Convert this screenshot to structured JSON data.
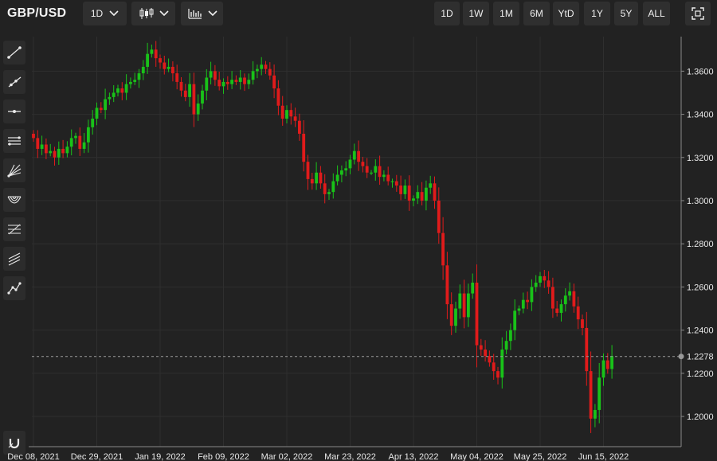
{
  "header": {
    "symbol": "GBP/USD",
    "interval": "1D",
    "ranges": [
      "1D",
      "1W",
      "1M",
      "6M",
      "YtD",
      "1Y",
      "5Y",
      "ALL"
    ],
    "icons": [
      "chevron-down-icon",
      "candlestick-icon",
      "chart-type-icon",
      "fullscreen-icon"
    ]
  },
  "drawing_tools": [
    "trend-line-icon",
    "ray-icon",
    "horizontal-line-icon",
    "parallel-channel-icon",
    "fan-icon",
    "arc-icon",
    "fibonacci-icon",
    "gann-icon",
    "path-icon",
    "magnet-icon"
  ],
  "colors": {
    "up": "#19c219",
    "down": "#e01b1b",
    "background": "#222222",
    "grid": "#2f2f2f"
  },
  "chart_data": {
    "type": "candlestick",
    "title": "GBP/USD",
    "xlabel": "",
    "ylabel": "",
    "ylim": [
      1.186,
      1.376
    ],
    "y_ticks": [
      1.36,
      1.34,
      1.32,
      1.3,
      1.28,
      1.26,
      1.24,
      1.22,
      1.2
    ],
    "y_tick_labels": [
      "1.3600",
      "1.3400",
      "1.3200",
      "1.3000",
      "1.2800",
      "1.2600",
      "1.2400",
      "1.2200",
      "1.2000"
    ],
    "x_tick_labels": [
      "Dec 08, 2021",
      "Dec 29, 2021",
      "Jan 19, 2022",
      "Feb 09, 2022",
      "Mar 02, 2022",
      "Mar 23, 2022",
      "Apr 13, 2022",
      "May 04, 2022",
      "May 25, 2022",
      "Jun 15, 2022"
    ],
    "x_tick_index": [
      0,
      15,
      30,
      45,
      60,
      75,
      90,
      105,
      120,
      135
    ],
    "last_price": 1.2278,
    "last_price_label": "1.2278",
    "grid": true,
    "closes": [
      1.329,
      1.324,
      1.326,
      1.322,
      1.323,
      1.32,
      1.324,
      1.322,
      1.325,
      1.329,
      1.33,
      1.324,
      1.327,
      1.334,
      1.338,
      1.343,
      1.342,
      1.347,
      1.348,
      1.35,
      1.352,
      1.35,
      1.354,
      1.355,
      1.356,
      1.359,
      1.362,
      1.368,
      1.37,
      1.366,
      1.364,
      1.361,
      1.362,
      1.359,
      1.355,
      1.351,
      1.348,
      1.354,
      1.34,
      1.345,
      1.351,
      1.357,
      1.36,
      1.356,
      1.353,
      1.355,
      1.354,
      1.356,
      1.355,
      1.357,
      1.354,
      1.356,
      1.36,
      1.361,
      1.363,
      1.361,
      1.358,
      1.352,
      1.344,
      1.338,
      1.342,
      1.339,
      1.337,
      1.331,
      1.318,
      1.31,
      1.308,
      1.313,
      1.308,
      1.303,
      1.304,
      1.309,
      1.312,
      1.314,
      1.315,
      1.319,
      1.323,
      1.318,
      1.316,
      1.313,
      1.313,
      1.316,
      1.311,
      1.312,
      1.309,
      1.309,
      1.307,
      1.303,
      1.307,
      1.3,
      1.301,
      1.304,
      1.3,
      1.306,
      1.308,
      1.3,
      1.285,
      1.27,
      1.252,
      1.242,
      1.25,
      1.257,
      1.246,
      1.257,
      1.262,
      1.233,
      1.231,
      1.228,
      1.225,
      1.221,
      1.218,
      1.231,
      1.235,
      1.24,
      1.249,
      1.25,
      1.254,
      1.253,
      1.26,
      1.262,
      1.265,
      1.263,
      1.26,
      1.25,
      1.248,
      1.252,
      1.256,
      1.258,
      1.251,
      1.245,
      1.241,
      1.221,
      1.199,
      1.203,
      1.218,
      1.226,
      1.222,
      1.228
    ]
  }
}
